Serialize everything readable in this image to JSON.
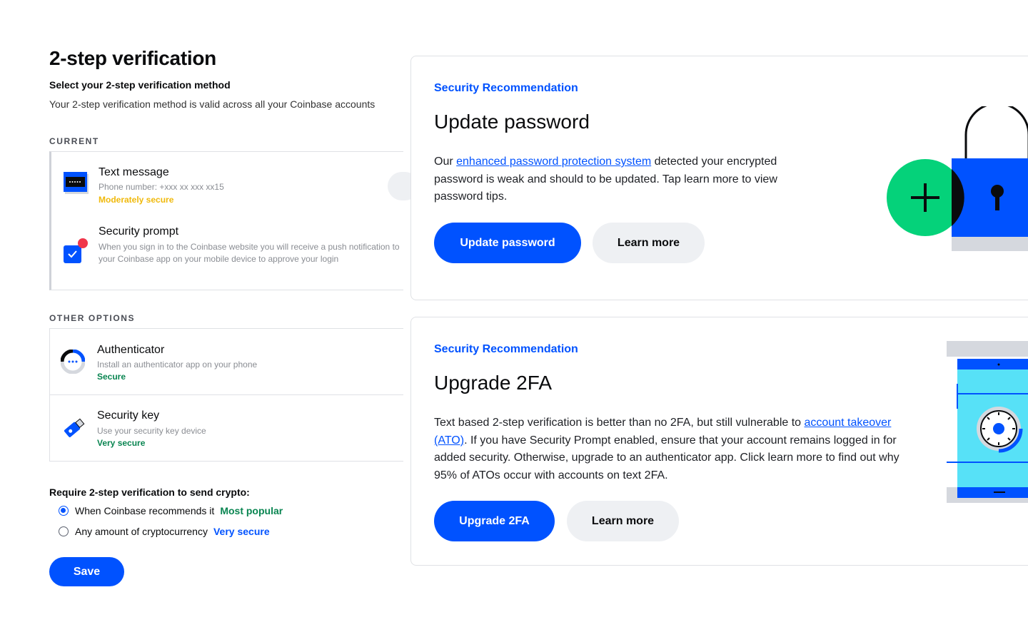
{
  "page": {
    "title": "2-step verification",
    "subtitle": "Select your 2-step verification method",
    "description": "Your 2-step verification method is valid across all your Coinbase accounts"
  },
  "current": {
    "section_label": "CURRENT",
    "methods": [
      {
        "title": "Text message",
        "subtitle": "Phone number: +xxx xx xxx xx15",
        "level": "Moderately secure",
        "level_color": "#f0b90b",
        "icon": "sms-icon"
      },
      {
        "title": "Security prompt",
        "subtitle": "When you sign in to the Coinbase website you will receive a push notification to your Coinbase app on your mobile device to approve your login",
        "icon": "security-prompt-icon"
      }
    ]
  },
  "other": {
    "section_label": "OTHER OPTIONS",
    "methods": [
      {
        "title": "Authenticator",
        "subtitle": "Install an authenticator app on your phone",
        "level": "Secure",
        "level_color": "#098551",
        "icon": "authenticator-icon"
      },
      {
        "title": "Security key",
        "subtitle": "Use your security key device",
        "level": "Very secure",
        "level_color": "#098551",
        "icon": "security-key-icon"
      }
    ]
  },
  "send_crypto": {
    "label": "Require 2-step verification to send crypto:",
    "options": [
      {
        "label": "When Coinbase recommends it",
        "tag": "Most popular",
        "tag_color": "#098551",
        "checked": true
      },
      {
        "label": "Any amount of cryptocurrency",
        "tag": "Very secure",
        "tag_color": "#0052ff",
        "checked": false
      }
    ],
    "save_label": "Save"
  },
  "cards": [
    {
      "kicker": "Security Recommendation",
      "title": "Update password",
      "body_pre": "Our ",
      "body_link": "enhanced password protection system",
      "body_post": " detected your encrypted password is weak and should to be updated. Tap learn more to view password tips.",
      "primary_label": "Update password",
      "secondary_label": "Learn more",
      "illustration": "padlock-plus-icon"
    },
    {
      "kicker": "Security Recommendation",
      "title": "Upgrade 2FA",
      "body_pre": "Text based 2-step verification is better than no 2FA, but still vulnerable to ",
      "body_link": "account takeover (ATO)",
      "body_post": ". If you have Security Prompt enabled, ensure that your account remains logged in for added security. Otherwise, upgrade to an authenticator app. Click learn more to find out why 95% of ATOs occur with accounts on text 2FA.",
      "primary_label": "Upgrade 2FA",
      "secondary_label": "Learn more",
      "illustration": "phone-vault-icon"
    }
  ],
  "colors": {
    "accent": "#0052ff",
    "success": "#098551",
    "warning": "#f0b90b",
    "illustration_green": "#05d27a",
    "illustration_cyan": "#57e1f7"
  }
}
